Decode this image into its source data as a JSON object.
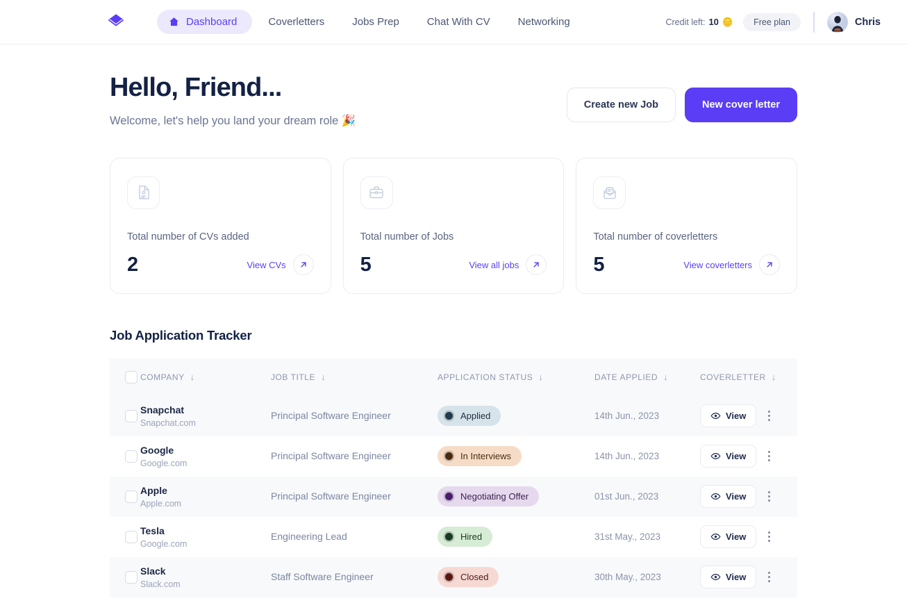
{
  "brand": {
    "logo_icon": "layers-diamond-logo",
    "accent": "#5b3df5"
  },
  "nav": {
    "items": [
      {
        "label": "Dashboard",
        "icon": "home-icon",
        "active": true
      },
      {
        "label": "Coverletters",
        "active": false
      },
      {
        "label": "Jobs Prep",
        "active": false
      },
      {
        "label": "Chat With CV",
        "active": false
      },
      {
        "label": "Networking",
        "active": false
      }
    ]
  },
  "account": {
    "credit_label": "Credit left:",
    "credit_value": "10",
    "credit_icon": "coins-icon",
    "plan": "Free plan",
    "username": "Chris",
    "avatar_icon": "user-avatar"
  },
  "hero": {
    "greeting": "Hello, Friend...",
    "subtitle": "Welcome, let's help you land your dream role 🎉",
    "create_job_label": "Create new Job",
    "new_cover_letter_label": "New cover letter"
  },
  "stats": [
    {
      "icon": "cv-document-icon",
      "label": "Total number of CVs added",
      "value": "2",
      "link_label": "View CVs",
      "link_icon": "arrow-up-right-icon"
    },
    {
      "icon": "briefcase-icon",
      "label": "Total number of Jobs",
      "value": "5",
      "link_label": "View all jobs",
      "link_icon": "arrow-up-right-icon"
    },
    {
      "icon": "envelope-letter-icon",
      "label": "Total number of coverletters",
      "value": "5",
      "link_label": "View coverletters",
      "link_icon": "arrow-up-right-icon"
    }
  ],
  "tracker": {
    "title": "Job Application Tracker",
    "sort_icon": "↓",
    "columns": [
      {
        "label": "COMPANY"
      },
      {
        "label": "JOB TITLE"
      },
      {
        "label": "APPLICATION STATUS"
      },
      {
        "label": "DATE APPLIED"
      },
      {
        "label": "COVERLETTER"
      }
    ],
    "view_label": "View",
    "view_icon": "eye-icon",
    "menu_icon": "kebab-menu-icon",
    "rows": [
      {
        "company": "Snapchat",
        "domain": "Snapchat.com",
        "job_title": "Principal Software Engineer",
        "status": "Applied",
        "status_bg": "#d7e3ea",
        "status_fg": "#203040",
        "status_dot": "#1f3a4d",
        "date": "14th Jun., 2023"
      },
      {
        "company": "Google",
        "domain": "Google.com",
        "job_title": "Principal Software Engineer",
        "status": "In Interviews",
        "status_bg": "#f6dcc6",
        "status_fg": "#4a2c12",
        "status_dot": "#4a2a0d",
        "date": "14th Jun., 2023"
      },
      {
        "company": "Apple",
        "domain": "Apple.com",
        "job_title": "Principal Software Engineer",
        "status": "Negotiating Offer",
        "status_bg": "#e6d9ee",
        "status_fg": "#3d2150",
        "status_dot": "#4a1d6b",
        "date": "01st Jun., 2023"
      },
      {
        "company": "Tesla",
        "domain": "Google.com",
        "job_title": "Engineering Lead",
        "status": "Hired",
        "status_bg": "#d6ecd4",
        "status_fg": "#1d3a1d",
        "status_dot": "#153c21",
        "date": "31st May., 2023"
      },
      {
        "company": "Slack",
        "domain": "Slack.com",
        "job_title": "Staff Software Engineer",
        "status": "Closed",
        "status_bg": "#f7d9d4",
        "status_fg": "#4a1a14",
        "status_dot": "#5a1710",
        "date": "30th May., 2023"
      }
    ]
  }
}
